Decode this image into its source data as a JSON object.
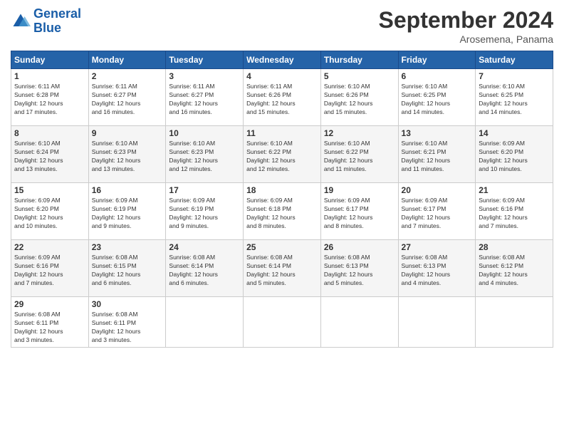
{
  "header": {
    "logo_line1": "General",
    "logo_line2": "Blue",
    "month_title": "September 2024",
    "location": "Arosemena, Panama"
  },
  "days_of_week": [
    "Sunday",
    "Monday",
    "Tuesday",
    "Wednesday",
    "Thursday",
    "Friday",
    "Saturday"
  ],
  "weeks": [
    [
      {
        "day": "1",
        "sunrise": "6:11 AM",
        "sunset": "6:28 PM",
        "daylight": "12 hours and 17 minutes."
      },
      {
        "day": "2",
        "sunrise": "6:11 AM",
        "sunset": "6:27 PM",
        "daylight": "12 hours and 16 minutes."
      },
      {
        "day": "3",
        "sunrise": "6:11 AM",
        "sunset": "6:27 PM",
        "daylight": "12 hours and 16 minutes."
      },
      {
        "day": "4",
        "sunrise": "6:11 AM",
        "sunset": "6:26 PM",
        "daylight": "12 hours and 15 minutes."
      },
      {
        "day": "5",
        "sunrise": "6:10 AM",
        "sunset": "6:26 PM",
        "daylight": "12 hours and 15 minutes."
      },
      {
        "day": "6",
        "sunrise": "6:10 AM",
        "sunset": "6:25 PM",
        "daylight": "12 hours and 14 minutes."
      },
      {
        "day": "7",
        "sunrise": "6:10 AM",
        "sunset": "6:25 PM",
        "daylight": "12 hours and 14 minutes."
      }
    ],
    [
      {
        "day": "8",
        "sunrise": "6:10 AM",
        "sunset": "6:24 PM",
        "daylight": "12 hours and 13 minutes."
      },
      {
        "day": "9",
        "sunrise": "6:10 AM",
        "sunset": "6:23 PM",
        "daylight": "12 hours and 13 minutes."
      },
      {
        "day": "10",
        "sunrise": "6:10 AM",
        "sunset": "6:23 PM",
        "daylight": "12 hours and 12 minutes."
      },
      {
        "day": "11",
        "sunrise": "6:10 AM",
        "sunset": "6:22 PM",
        "daylight": "12 hours and 12 minutes."
      },
      {
        "day": "12",
        "sunrise": "6:10 AM",
        "sunset": "6:22 PM",
        "daylight": "12 hours and 11 minutes."
      },
      {
        "day": "13",
        "sunrise": "6:10 AM",
        "sunset": "6:21 PM",
        "daylight": "12 hours and 11 minutes."
      },
      {
        "day": "14",
        "sunrise": "6:09 AM",
        "sunset": "6:20 PM",
        "daylight": "12 hours and 10 minutes."
      }
    ],
    [
      {
        "day": "15",
        "sunrise": "6:09 AM",
        "sunset": "6:20 PM",
        "daylight": "12 hours and 10 minutes."
      },
      {
        "day": "16",
        "sunrise": "6:09 AM",
        "sunset": "6:19 PM",
        "daylight": "12 hours and 9 minutes."
      },
      {
        "day": "17",
        "sunrise": "6:09 AM",
        "sunset": "6:19 PM",
        "daylight": "12 hours and 9 minutes."
      },
      {
        "day": "18",
        "sunrise": "6:09 AM",
        "sunset": "6:18 PM",
        "daylight": "12 hours and 8 minutes."
      },
      {
        "day": "19",
        "sunrise": "6:09 AM",
        "sunset": "6:17 PM",
        "daylight": "12 hours and 8 minutes."
      },
      {
        "day": "20",
        "sunrise": "6:09 AM",
        "sunset": "6:17 PM",
        "daylight": "12 hours and 7 minutes."
      },
      {
        "day": "21",
        "sunrise": "6:09 AM",
        "sunset": "6:16 PM",
        "daylight": "12 hours and 7 minutes."
      }
    ],
    [
      {
        "day": "22",
        "sunrise": "6:09 AM",
        "sunset": "6:16 PM",
        "daylight": "12 hours and 7 minutes."
      },
      {
        "day": "23",
        "sunrise": "6:08 AM",
        "sunset": "6:15 PM",
        "daylight": "12 hours and 6 minutes."
      },
      {
        "day": "24",
        "sunrise": "6:08 AM",
        "sunset": "6:14 PM",
        "daylight": "12 hours and 6 minutes."
      },
      {
        "day": "25",
        "sunrise": "6:08 AM",
        "sunset": "6:14 PM",
        "daylight": "12 hours and 5 minutes."
      },
      {
        "day": "26",
        "sunrise": "6:08 AM",
        "sunset": "6:13 PM",
        "daylight": "12 hours and 5 minutes."
      },
      {
        "day": "27",
        "sunrise": "6:08 AM",
        "sunset": "6:13 PM",
        "daylight": "12 hours and 4 minutes."
      },
      {
        "day": "28",
        "sunrise": "6:08 AM",
        "sunset": "6:12 PM",
        "daylight": "12 hours and 4 minutes."
      }
    ],
    [
      {
        "day": "29",
        "sunrise": "6:08 AM",
        "sunset": "6:11 PM",
        "daylight": "12 hours and 3 minutes."
      },
      {
        "day": "30",
        "sunrise": "6:08 AM",
        "sunset": "6:11 PM",
        "daylight": "12 hours and 3 minutes."
      },
      null,
      null,
      null,
      null,
      null
    ]
  ],
  "labels": {
    "sunrise": "Sunrise:",
    "sunset": "Sunset:",
    "daylight": "Daylight:"
  }
}
